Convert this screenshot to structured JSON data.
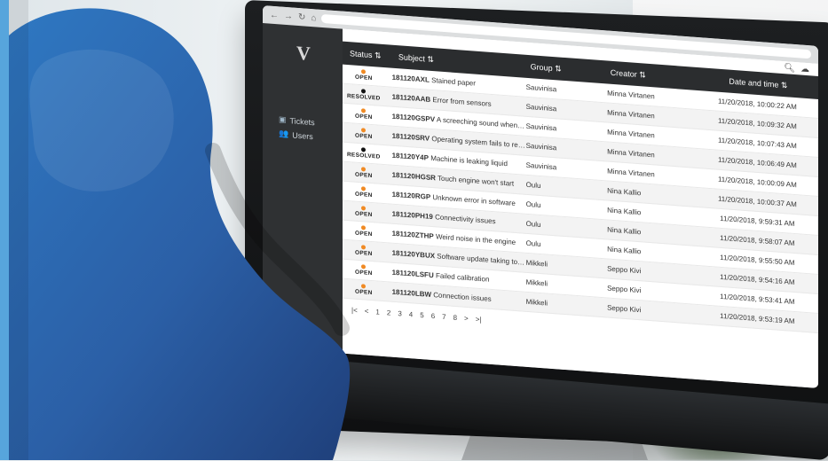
{
  "colors": {
    "open": "#f08a24",
    "resolved": "#111111",
    "accent_stripe": "#57a5dc"
  },
  "browser": {
    "nav_icons": [
      "back-arrow-icon",
      "forward-arrow-icon",
      "refresh-icon",
      "home-icon"
    ],
    "right_icons": [
      "search-icon",
      "cloud-icon"
    ]
  },
  "sidebar": {
    "logo": "V",
    "items": [
      {
        "label": "Tickets",
        "icon": "ticket-icon"
      },
      {
        "label": "Users",
        "icon": "users-icon"
      }
    ]
  },
  "table": {
    "headers": {
      "status": "Status",
      "subject": "Subject",
      "group": "Group",
      "creator": "Creator",
      "datetime": "Date and time"
    },
    "rows": [
      {
        "status": "OPEN",
        "id": "181120AXL",
        "subject": "Stained paper",
        "group": "Sauvinisa",
        "creator": "Minna Virtanen",
        "datetime": "11/20/2018, 10:00:22 AM"
      },
      {
        "status": "RESOLVED",
        "id": "181120AAB",
        "subject": "Error from sensors",
        "group": "Sauvinisa",
        "creator": "Minna Virtanen",
        "datetime": "11/20/2018, 10:09:32 AM"
      },
      {
        "status": "OPEN",
        "id": "181120GSPV",
        "subject": "A screeching sound when printing",
        "group": "Sauvinisa",
        "creator": "Minna Virtanen",
        "datetime": "11/20/2018, 10:07:43 AM"
      },
      {
        "status": "OPEN",
        "id": "181120SRV",
        "subject": "Operating system fails to respond",
        "group": "Sauvinisa",
        "creator": "Minna Virtanen",
        "datetime": "11/20/2018, 10:06:49 AM"
      },
      {
        "status": "RESOLVED",
        "id": "181120Y4P",
        "subject": "Machine is leaking liquid",
        "group": "Sauvinisa",
        "creator": "Minna Virtanen",
        "datetime": "11/20/2018, 10:00:09 AM"
      },
      {
        "status": "OPEN",
        "id": "181120HGSR",
        "subject": "Touch engine won't start",
        "group": "Oulu",
        "creator": "Nina Kallio",
        "datetime": "11/20/2018, 10:00:37 AM"
      },
      {
        "status": "OPEN",
        "id": "181120RGP",
        "subject": "Unknown error in software",
        "group": "Oulu",
        "creator": "Nina Kallio",
        "datetime": "11/20/2018, 9:59:31 AM"
      },
      {
        "status": "OPEN",
        "id": "181120PH19",
        "subject": "Connectivity issues",
        "group": "Oulu",
        "creator": "Nina Kallio",
        "datetime": "11/20/2018, 9:58:07 AM"
      },
      {
        "status": "OPEN",
        "id": "181120ZTHP",
        "subject": "Weird noise in the engine",
        "group": "Oulu",
        "creator": "Nina Kallio",
        "datetime": "11/20/2018, 9:55:50 AM"
      },
      {
        "status": "OPEN",
        "id": "181120YBUX",
        "subject": "Software update taking too long",
        "group": "Mikkeli",
        "creator": "Seppo Kivi",
        "datetime": "11/20/2018, 9:54:16 AM"
      },
      {
        "status": "OPEN",
        "id": "181120LSFU",
        "subject": "Failed calibration",
        "group": "Mikkeli",
        "creator": "Seppo Kivi",
        "datetime": "11/20/2018, 9:53:41 AM"
      },
      {
        "status": "OPEN",
        "id": "181120LBW",
        "subject": "Connection issues",
        "group": "Mikkeli",
        "creator": "Seppo Kivi",
        "datetime": "11/20/2018, 9:53:19 AM"
      }
    ]
  },
  "pagination": {
    "first": "|<",
    "prev": "<",
    "pages": [
      "1",
      "2",
      "3",
      "4",
      "5",
      "6",
      "7",
      "8"
    ],
    "next": ">",
    "last": ">|"
  }
}
